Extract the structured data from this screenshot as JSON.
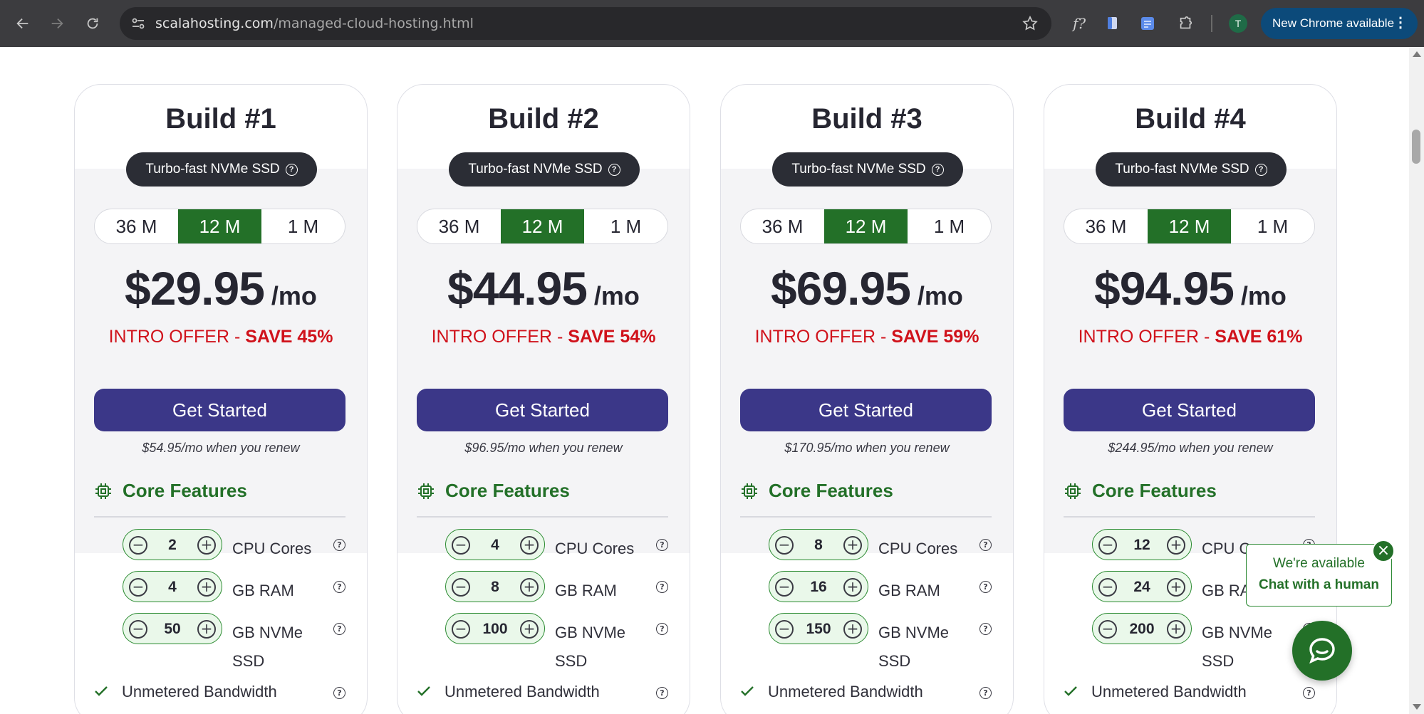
{
  "browser": {
    "url_host": "scalahosting.com",
    "url_path": "/managed-cloud-hosting.html",
    "update_label": "New Chrome available",
    "profile_initial": "T",
    "extension_fx_label": "f?"
  },
  "plans": [
    {
      "title": "Build #1",
      "storage_badge": "Turbo-fast NVMe SSD",
      "terms": [
        "36 M",
        "12 M",
        "1 M"
      ],
      "selected_term": "12 M",
      "price": "$29.95",
      "per": "/mo",
      "offer_text": "INTRO OFFER - ",
      "save_text": "SAVE 45%",
      "cta": "Get Started",
      "renew_text": "$54.95/mo when you renew",
      "core_features_title": "Core Features",
      "cpu": "2",
      "cpu_label": "CPU Cores",
      "ram": "4",
      "ram_label": "GB RAM",
      "ssd": "50",
      "ssd_label": "GB NVMe SSD",
      "bandwidth_label": "Unmetered Bandwidth"
    },
    {
      "title": "Build #2",
      "storage_badge": "Turbo-fast NVMe SSD",
      "terms": [
        "36 M",
        "12 M",
        "1 M"
      ],
      "selected_term": "12 M",
      "price": "$44.95",
      "per": "/mo",
      "offer_text": "INTRO OFFER - ",
      "save_text": "SAVE 54%",
      "cta": "Get Started",
      "renew_text": "$96.95/mo when you renew",
      "core_features_title": "Core Features",
      "cpu": "4",
      "cpu_label": "CPU Cores",
      "ram": "8",
      "ram_label": "GB RAM",
      "ssd": "100",
      "ssd_label": "GB NVMe SSD",
      "bandwidth_label": "Unmetered Bandwidth"
    },
    {
      "title": "Build #3",
      "storage_badge": "Turbo-fast NVMe SSD",
      "terms": [
        "36 M",
        "12 M",
        "1 M"
      ],
      "selected_term": "12 M",
      "price": "$69.95",
      "per": "/mo",
      "offer_text": "INTRO OFFER - ",
      "save_text": "SAVE 59%",
      "cta": "Get Started",
      "renew_text": "$170.95/mo when you renew",
      "core_features_title": "Core Features",
      "cpu": "8",
      "cpu_label": "CPU Cores",
      "ram": "16",
      "ram_label": "GB RAM",
      "ssd": "150",
      "ssd_label": "GB NVMe SSD",
      "bandwidth_label": "Unmetered Bandwidth"
    },
    {
      "title": "Build #4",
      "storage_badge": "Turbo-fast NVMe SSD",
      "terms": [
        "36 M",
        "12 M",
        "1 M"
      ],
      "selected_term": "12 M",
      "price": "$94.95",
      "per": "/mo",
      "offer_text": "INTRO OFFER - ",
      "save_text": "SAVE 61%",
      "cta": "Get Started",
      "renew_text": "$244.95/mo when you renew",
      "core_features_title": "Core Features",
      "cpu": "12",
      "cpu_label": "CPU Cores",
      "ram": "24",
      "ram_label": "GB RAM",
      "ssd": "200",
      "ssd_label": "GB NVMe SSD",
      "bandwidth_label": "Unmetered Bandwidth"
    }
  ],
  "chat": {
    "line1": "We're available",
    "line2": "Chat with a human"
  },
  "colors": {
    "accent_green": "#237028",
    "cta_purple": "#3b3788",
    "offer_red": "#d0121b",
    "badge_dark": "#2b2d35"
  },
  "icons": {
    "storage_help": "question-circle-icon",
    "core_features": "cpu-chip-icon",
    "bandwidth": "check-icon",
    "chat_launcher": "chat-bubble-icon"
  }
}
